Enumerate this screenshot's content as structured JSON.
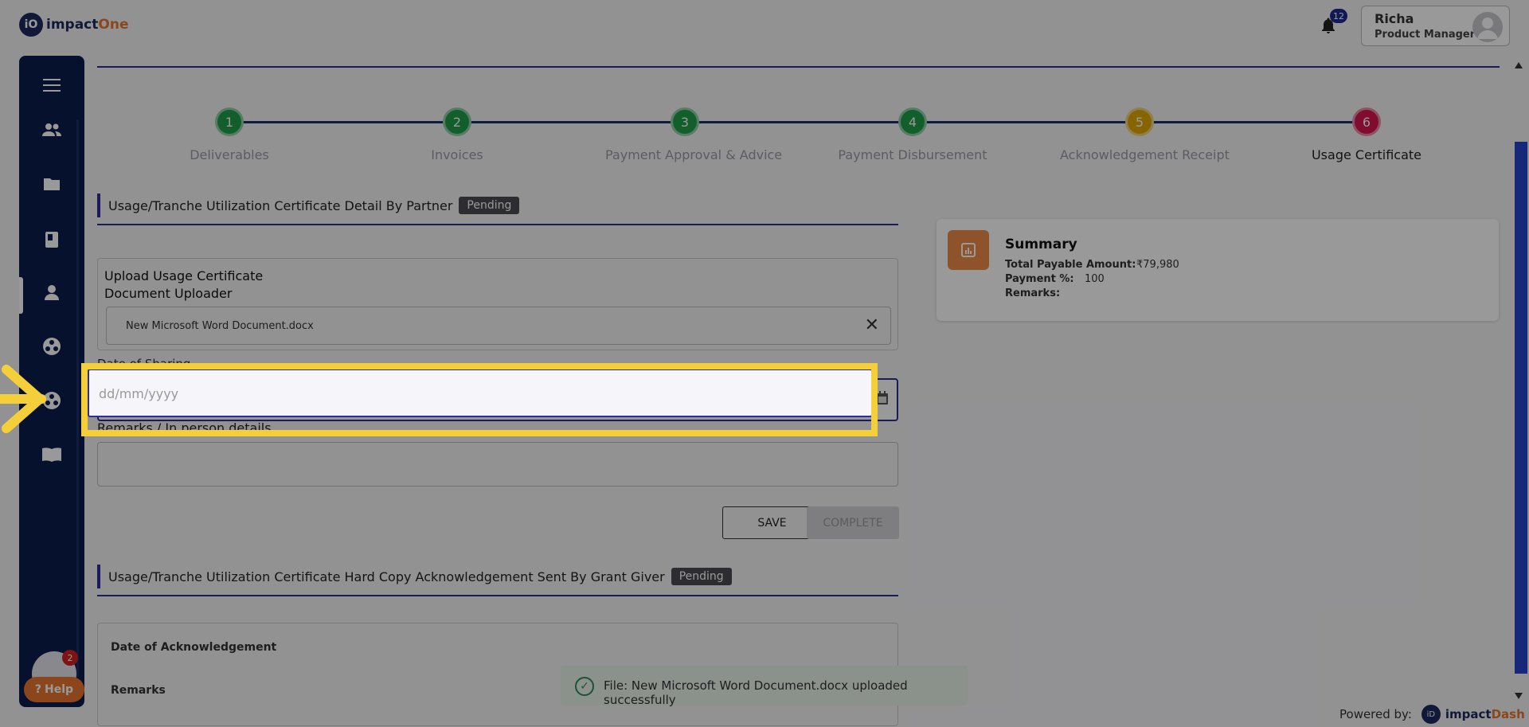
{
  "header": {
    "logo_mark": "iO",
    "logo_word": "impact",
    "logo_accent": "One",
    "notification_count": "12",
    "user_name": "Richa",
    "user_role": "Product Manager"
  },
  "sidebar": {
    "icons": [
      "menu-icon",
      "team-icon",
      "folder-icon",
      "book-icon",
      "person-icon",
      "hub-icon",
      "hub-alt-icon",
      "manual-icon"
    ]
  },
  "steps": [
    {
      "number": "1",
      "label": "Deliverables",
      "status": "done",
      "color": "#1e9e4a"
    },
    {
      "number": "2",
      "label": "Invoices",
      "status": "done",
      "color": "#1e9e4a"
    },
    {
      "number": "3",
      "label": "Payment Approval & Advice",
      "status": "done",
      "color": "#1e9e4a"
    },
    {
      "number": "4",
      "label": "Payment Disbursement",
      "status": "done",
      "color": "#1e9e4a"
    },
    {
      "number": "5",
      "label": "Acknowledgement Receipt",
      "status": "warning",
      "color": "#e0a800"
    },
    {
      "number": "6",
      "label": "Usage Certificate",
      "status": "current",
      "color": "#d81450"
    }
  ],
  "section1": {
    "title": "Usage/Tranche Utilization Certificate Detail By Partner",
    "badge": "Pending",
    "upload_heading": "Upload Usage Certificate",
    "uploader_label": "Document Uploader",
    "uploaded_file": "New Microsoft Word Document.docx",
    "date_label": "Date of Sharing",
    "date_placeholder": "dd/mm/yyyy",
    "remarks_label": "Remarks / In person details",
    "save_label": "SAVE",
    "complete_label": "COMPLETE"
  },
  "section2": {
    "title": "Usage/Tranche Utilization Certificate Hard Copy Acknowledgement Sent By Grant Giver",
    "badge": "Pending",
    "field1": "Date of Acknowledgement",
    "field2": "Remarks"
  },
  "summary": {
    "title": "Summary",
    "total_label": "Total Payable Amount:",
    "total_value": "₹79,980",
    "payment_label": "Payment %:",
    "payment_value": "100",
    "remarks_label": "Remarks:"
  },
  "toast": {
    "message": "File: New Microsoft Word Document.docx uploaded successfully"
  },
  "help": {
    "label": "Help",
    "chat_count": "2"
  },
  "footer": {
    "powered_by": "Powered by:",
    "brand_mark": "iD",
    "brand_word": "impact",
    "brand_accent": "Dash"
  },
  "colors": {
    "sidebar": "#0b1d4d",
    "accent": "#2d2d9a",
    "highlight": "#f5cf3a",
    "help": "#e8772e"
  }
}
